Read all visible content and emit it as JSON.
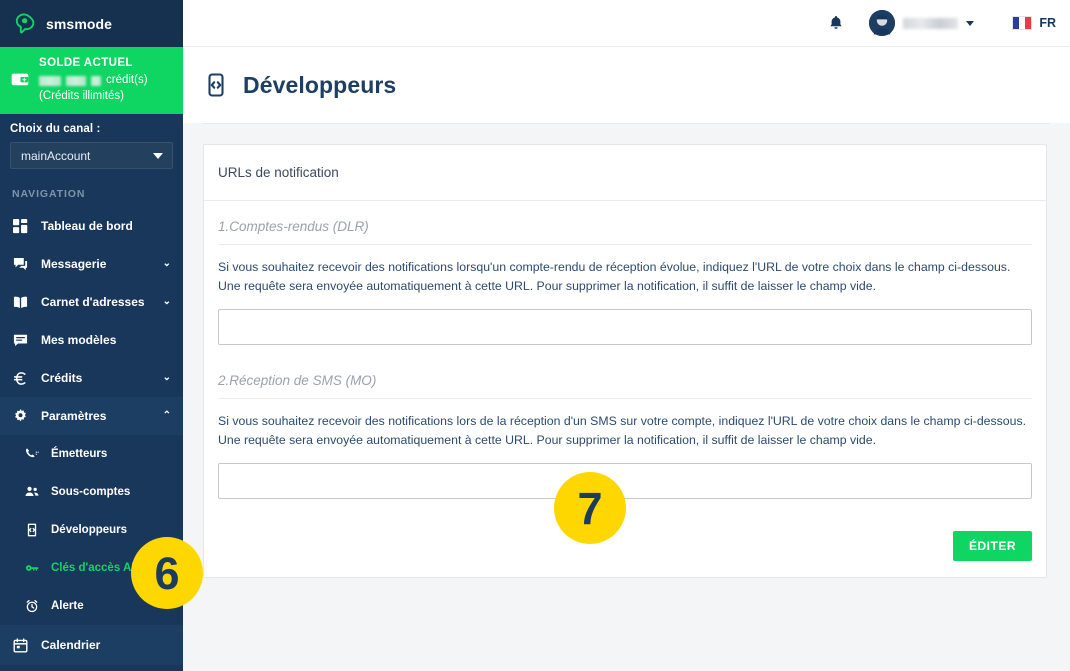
{
  "brand": {
    "name": "smsmode",
    "logo_icon": "speech-bubble-logo",
    "logo_color": "#0fd663"
  },
  "balance": {
    "title": "SOLDE ACTUEL",
    "credits_unit": "crédit(s)",
    "subtitle": "(Crédits illimités)",
    "icon": "wallet-icon",
    "background_color": "#0fd663"
  },
  "channel": {
    "label": "Choix du canal :",
    "selected": "mainAccount",
    "caret_icon": "chevron-down-icon"
  },
  "sidebar": {
    "nav_heading": "NAVIGATION",
    "items": [
      {
        "label": "Tableau de bord",
        "icon": "dashboard-icon",
        "chevron": ""
      },
      {
        "label": "Messagerie",
        "icon": "chat-icon",
        "chevron": "⌄"
      },
      {
        "label": "Carnet d'adresses",
        "icon": "address-book-icon",
        "chevron": "⌄"
      },
      {
        "label": "Mes modèles",
        "icon": "template-icon",
        "chevron": ""
      },
      {
        "label": "Crédits",
        "icon": "euro-icon",
        "chevron": "⌄"
      },
      {
        "label": "Paramètres",
        "icon": "gear-icon",
        "chevron": "⌃"
      }
    ],
    "sub_items": [
      {
        "label": "Émetteurs",
        "icon": "phone-icon",
        "active": false
      },
      {
        "label": "Sous-comptes",
        "icon": "users-icon",
        "active": false
      },
      {
        "label": "Développeurs",
        "icon": "developers-icon",
        "active": false
      },
      {
        "label": "Clés d'accès API",
        "icon": "key-icon",
        "active": true
      },
      {
        "label": "Alerte",
        "icon": "alarm-clock-icon",
        "active": false
      }
    ],
    "calendar": {
      "label": "Calendrier",
      "icon": "calendar-icon"
    },
    "active_color": "#0fd663"
  },
  "topbar": {
    "bell_icon": "bell-icon",
    "avatar_icon": "avatar",
    "user_caret_icon": "chevron-down-icon",
    "language": "FR",
    "flag_icon": "flag-france-icon"
  },
  "page": {
    "title": "Développeurs",
    "title_icon": "developers-icon"
  },
  "card": {
    "header": "URLs de notification",
    "sections": [
      {
        "title": "1.Comptes-rendus (DLR)",
        "paragraph": "Si vous souhaitez recevoir des notifications lorsqu'un compte-rendu de réception évolue, indiquez l'URL de votre choix dans le champ ci-dessous. Une requête sera envoyée automatiquement à cette URL. Pour supprimer la notification, il suffit de laisser le champ vide.",
        "input_value": "",
        "input_placeholder": ""
      },
      {
        "title": "2.Réception de SMS (MO)",
        "paragraph": "Si vous souhaitez recevoir des notifications lors de la réception d'un SMS sur votre compte, indiquez l'URL de votre choix dans le champ ci-dessous. Une requête sera envoyée automatiquement à cette URL. Pour supprimer la notification, il suffit de laisser le champ vide.",
        "input_value": "",
        "input_placeholder": ""
      }
    ],
    "edit_button": "ÉDITER",
    "button_color": "#0fd663"
  },
  "annotations": [
    {
      "number": "6",
      "color": "#ffd700"
    },
    {
      "number": "7",
      "color": "#ffd700"
    }
  ]
}
